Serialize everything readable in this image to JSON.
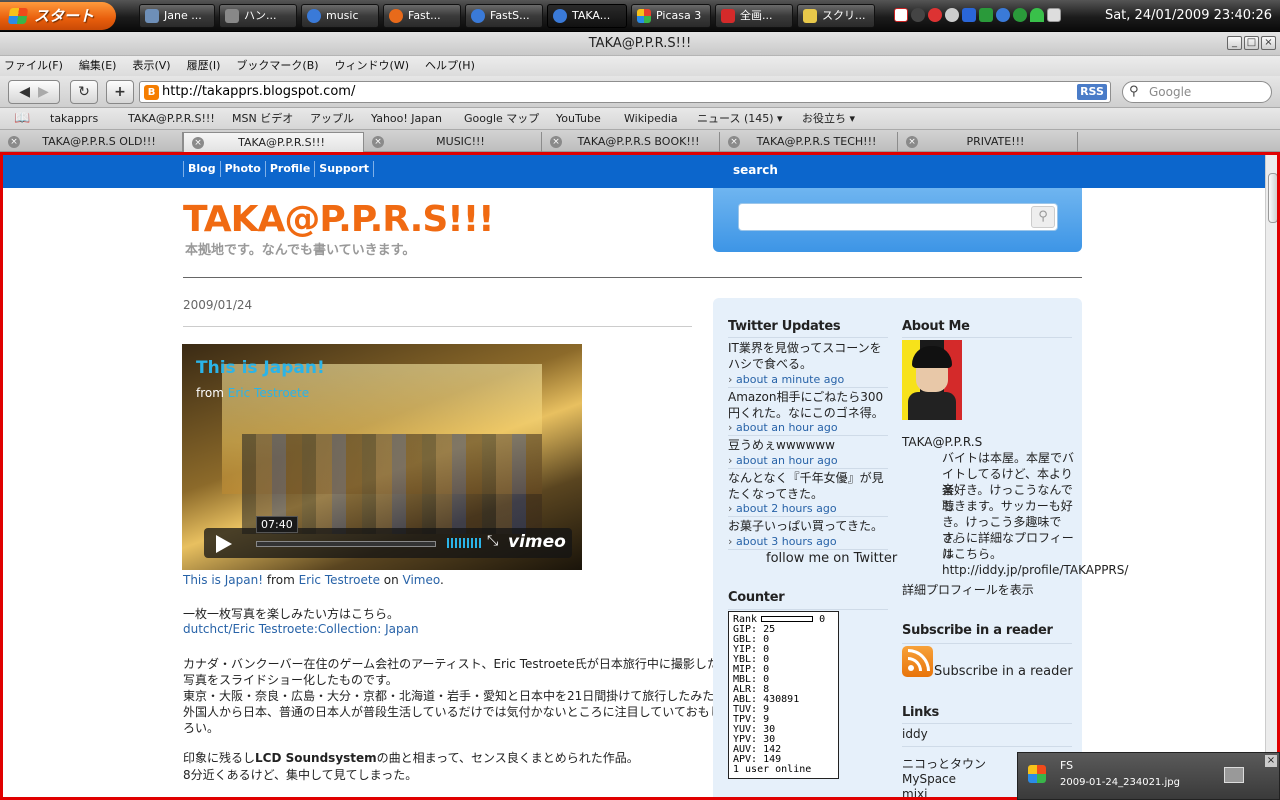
{
  "taskbar": {
    "start_label": "スタート",
    "tasks": [
      {
        "label": "Jane ...",
        "color": "#6e8fb8"
      },
      {
        "label": "ハン...",
        "color": "#888888"
      },
      {
        "label": "music",
        "color": "#3a7ad8"
      },
      {
        "label": "Fast...",
        "color": "#e86a1a"
      },
      {
        "label": "FastS...",
        "color": "#3a7ad8"
      },
      {
        "label": "TAKA...",
        "color": "#3a7ad8"
      },
      {
        "label": "Picasa 3",
        "color": "#e8402a"
      },
      {
        "label": "全画...",
        "color": "#d42a2a"
      },
      {
        "label": "スクリ...",
        "color": "#e8c84a"
      }
    ],
    "clock": "Sat, 24/01/2009 23:40:26"
  },
  "window": {
    "title": "TAKA@P.P.R.S!!!"
  },
  "menubar": [
    "ファイル(F)",
    "編集(E)",
    "表示(V)",
    "履歴(I)",
    "ブックマーク(B)",
    "ウィンドウ(W)",
    "ヘルプ(H)"
  ],
  "navbar": {
    "url": "http://takapprs.blogspot.com/",
    "rss": "RSS",
    "search_placeholder": "Google"
  },
  "bookmarks": [
    "takapprs",
    "TAKA@P.P.R.S!!!",
    "MSN ビデオ",
    "アップル",
    "Yahoo! Japan",
    "Google マップ",
    "YouTube",
    "Wikipedia",
    "ニュース (145)",
    "お役立ち"
  ],
  "tabs": [
    "TAKA@P.P.R.S OLD!!!",
    "TAKA@P.P.R.S!!!",
    "MUSIC!!!",
    "TAKA@P.P.R.S BOOK!!!",
    "TAKA@P.P.R.S TECH!!!",
    "PRIVATE!!!"
  ],
  "blog": {
    "topnav": [
      "Blog",
      "Photo",
      "Profile",
      "Support"
    ],
    "search_label": "search",
    "title": "TAKA@P.P.R.S!!!",
    "description": "本拠地です。なんでも書いていきます。",
    "post_date": "2009/01/24",
    "video": {
      "title": "This is Japan!",
      "from": "from",
      "author": "Eric Testroete",
      "time": "07:40",
      "brand": "vimeo"
    },
    "credit": {
      "title": "This is Japan!",
      "from": " from ",
      "author": "Eric Testroete",
      "on": " on ",
      "site": "Vimeo",
      "end": "."
    },
    "lines": {
      "l1": "一枚一枚写真を楽しみたい方はこちら。",
      "l2": "dutchct/Eric Testroete:Collection: Japan",
      "l3": "カナダ・バンクーバー在住のゲーム会社のアーティスト、Eric Testroete氏が日本旅行中に撮影した",
      "l4": "写真をスライドショー化したものです。",
      "l5": "東京・大阪・奈良・広島・大分・京都・北海道・岩手・愛知と日本中を21日間掛けて旅行したみたい。",
      "l6": "外国人から日本、普通の日本人が普段生活しているだけでは気付かないところに注目していておもし",
      "l7": "ろい。",
      "l8a": "印象に残るし",
      "l8b": "LCD Soundsystem",
      "l8c": "の曲と相まって、センス良くまとめられた作品。",
      "l9": "8分近くあるけど、集中して見てしまった。"
    }
  },
  "sidebar": {
    "twitter_title": "Twitter Updates",
    "tweets": [
      {
        "text": "IT業界を見做ってスコーンをハシで食べる。",
        "ago": "about a minute ago"
      },
      {
        "text": "Amazon相手にごねたら300円くれた。なにこのゴネ得。",
        "ago": "about an hour ago"
      },
      {
        "text": "豆うめぇwwwwww",
        "ago": "about an hour ago"
      },
      {
        "text": "なんとなく『千年女優』が見たくなってきた。",
        "ago": "about 2 hours ago"
      },
      {
        "text": "お菓子いっぱい買ってきた。",
        "ago": "about 3 hours ago"
      }
    ],
    "follow": "follow me on Twitter",
    "counter_title": "Counter",
    "counter": {
      "rank_label": "Rank",
      "rank_value": "0",
      "rows": [
        "GIP: 25",
        "GBL: 0",
        "YIP: 0",
        "YBL: 0",
        "MIP: 0",
        "MBL: 0",
        "ALR: 8",
        "ABL: 430891",
        "TUV: 9",
        "TPV: 9",
        "YUV: 30",
        "YPV: 30",
        "AUV: 142",
        "APV: 149"
      ],
      "online": "1 user online"
    },
    "about_title": "About Me",
    "about_name": "TAKA@P.P.R.S",
    "about_text": [
      "バイトは本屋。本屋でバ",
      "イトしてるけど、本より音",
      "楽好き。けっこうなんでも",
      "聴きます。サッカーも好",
      "き。けっこう多趣味です。",
      "さらに詳細なプロフィール",
      "はこちら。",
      "http://iddy.jp/profile/TAKAPPRS/"
    ],
    "profile_link": "詳細プロフィールを表示",
    "subscribe_title": "Subscribe in a reader",
    "subscribe_link": "Subscribe in a reader",
    "links_title": "Links",
    "links": [
      "iddy",
      "ニコっとタウン",
      "MySpace",
      "mixi"
    ]
  },
  "notification": {
    "title": "FS",
    "file": "2009-01-24_234021.jpg"
  }
}
